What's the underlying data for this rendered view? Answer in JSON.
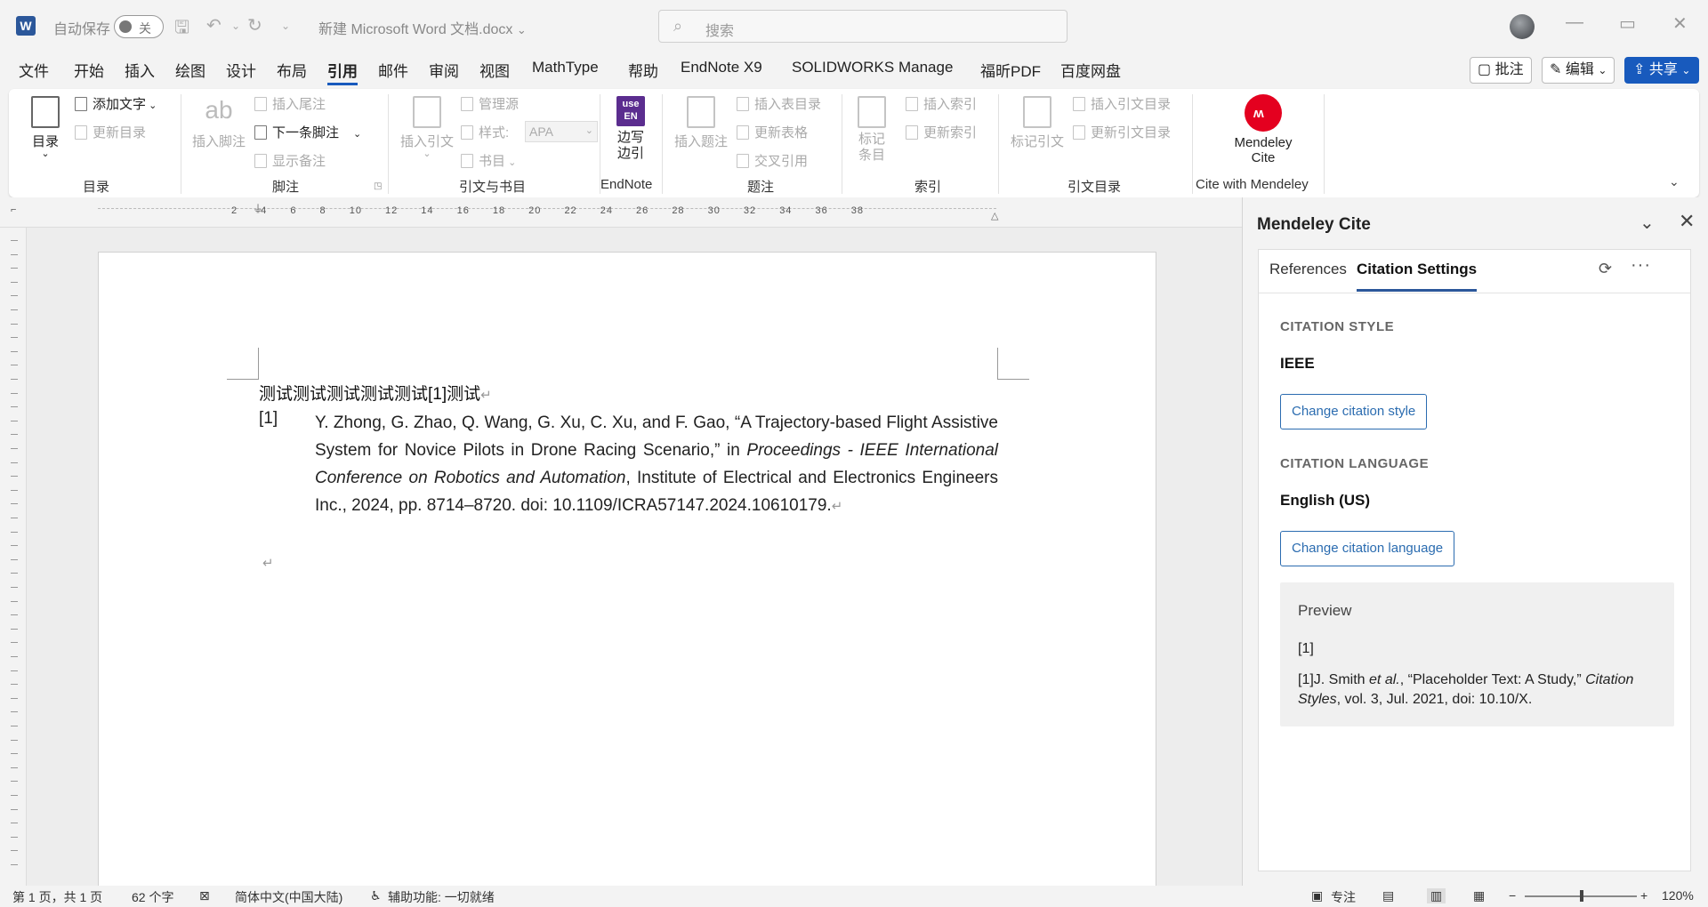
{
  "app": {
    "logo_letter": "W",
    "autosave_label": "自动保存",
    "autosave_state": "关",
    "doc_title": "新建 Microsoft Word 文档.docx",
    "search_placeholder": "搜索"
  },
  "menu_tabs": [
    "文件",
    "开始",
    "插入",
    "绘图",
    "设计",
    "布局",
    "引用",
    "邮件",
    "审阅",
    "视图",
    "MathType",
    "帮助",
    "EndNote X9",
    "SOLIDWORKS Manage",
    "福昕PDF",
    "百度网盘"
  ],
  "active_menu_tab": "引用",
  "top_buttons": {
    "comments": "批注",
    "editing": "编辑",
    "share": "共享"
  },
  "ribbon": {
    "toc": {
      "label": "目录",
      "group": "目录",
      "add_text": "添加文字",
      "update_toc": "更新目录"
    },
    "footnotes": {
      "group": "脚注",
      "insert_footnote": "插入脚注",
      "insert_endnote": "插入尾注",
      "next_footnote": "下一条脚注",
      "show_notes": "显示备注"
    },
    "citations": {
      "group": "引文与书目",
      "insert_citation": "插入引文",
      "manage_sources": "管理源",
      "style_label": "样式:",
      "style_value": "APA",
      "bibliography": "书目"
    },
    "endnote": {
      "group": "EndNote",
      "icon_text": "use EN",
      "button": "边写边引"
    },
    "captions": {
      "group": "题注",
      "insert_caption": "插入题注",
      "insert_table_of_figures": "插入表目录",
      "update_table": "更新表格",
      "cross_reference": "交叉引用"
    },
    "index": {
      "group": "索引",
      "mark_entry": "标记条目",
      "insert_index": "插入索引",
      "update_index": "更新索引"
    },
    "table_of_authorities": {
      "group": "引文目录",
      "mark_citation": "标记引文",
      "insert_toa": "插入引文目录",
      "update_toa": "更新引文目录"
    },
    "mendeley": {
      "group": "Cite with Mendeley",
      "button_line1": "Mendeley",
      "button_line2": "Cite"
    }
  },
  "ruler": {
    "numbers": "2 4 6 8 10 12 14 16 18 20 22 24 26 28 30 32 34 36 38"
  },
  "document": {
    "line1": "测试测试测试测试测试[1]测试",
    "ref_number": "[1]",
    "ref_text_1": "Y. Zhong, G. Zhao, Q. Wang, G. Xu, C. Xu, and F. Gao, “A Trajectory-based Flight Assistive System for Novice Pilots in Drone Racing Scenario,” in ",
    "ref_italic": "Proceedings - IEEE International Conference on Robotics and Automation",
    "ref_text_2": ", Institute of Electrical and Electronics Engineers Inc., 2024, pp. 8714–8720. doi: 10.1109/ICRA57147.2024.10610179."
  },
  "panel": {
    "title": "Mendeley Cite",
    "tabs": [
      "References",
      "Citation Settings"
    ],
    "active_tab": "Citation Settings",
    "citation_style_heading": "CITATION STYLE",
    "citation_style_value": "IEEE",
    "change_style_button": "Change citation style",
    "citation_language_heading": "CITATION LANGUAGE",
    "citation_language_value": "English (US)",
    "change_language_button": "Change citation language",
    "preview_title": "Preview",
    "preview_citation": "[1]",
    "preview_ref_prefix": "[1]J. Smith ",
    "preview_ref_etal": "et al.",
    "preview_ref_mid": ", “Placeholder Text: A Study,” ",
    "preview_ref_journal": "Citation Styles",
    "preview_ref_end": ", vol. 3, Jul. 2021, doi: 10.10/X."
  },
  "status": {
    "page": "第 1 页，共 1 页",
    "words": "62 个字",
    "language": "简体中文(中国大陆)",
    "accessibility": "辅助功能: 一切就绪",
    "focus": "专注",
    "zoom": "120%"
  },
  "colors": {
    "accent": "#185abd",
    "mendeley_red": "#e4001f",
    "endnote_purple": "#5b2d8f"
  }
}
